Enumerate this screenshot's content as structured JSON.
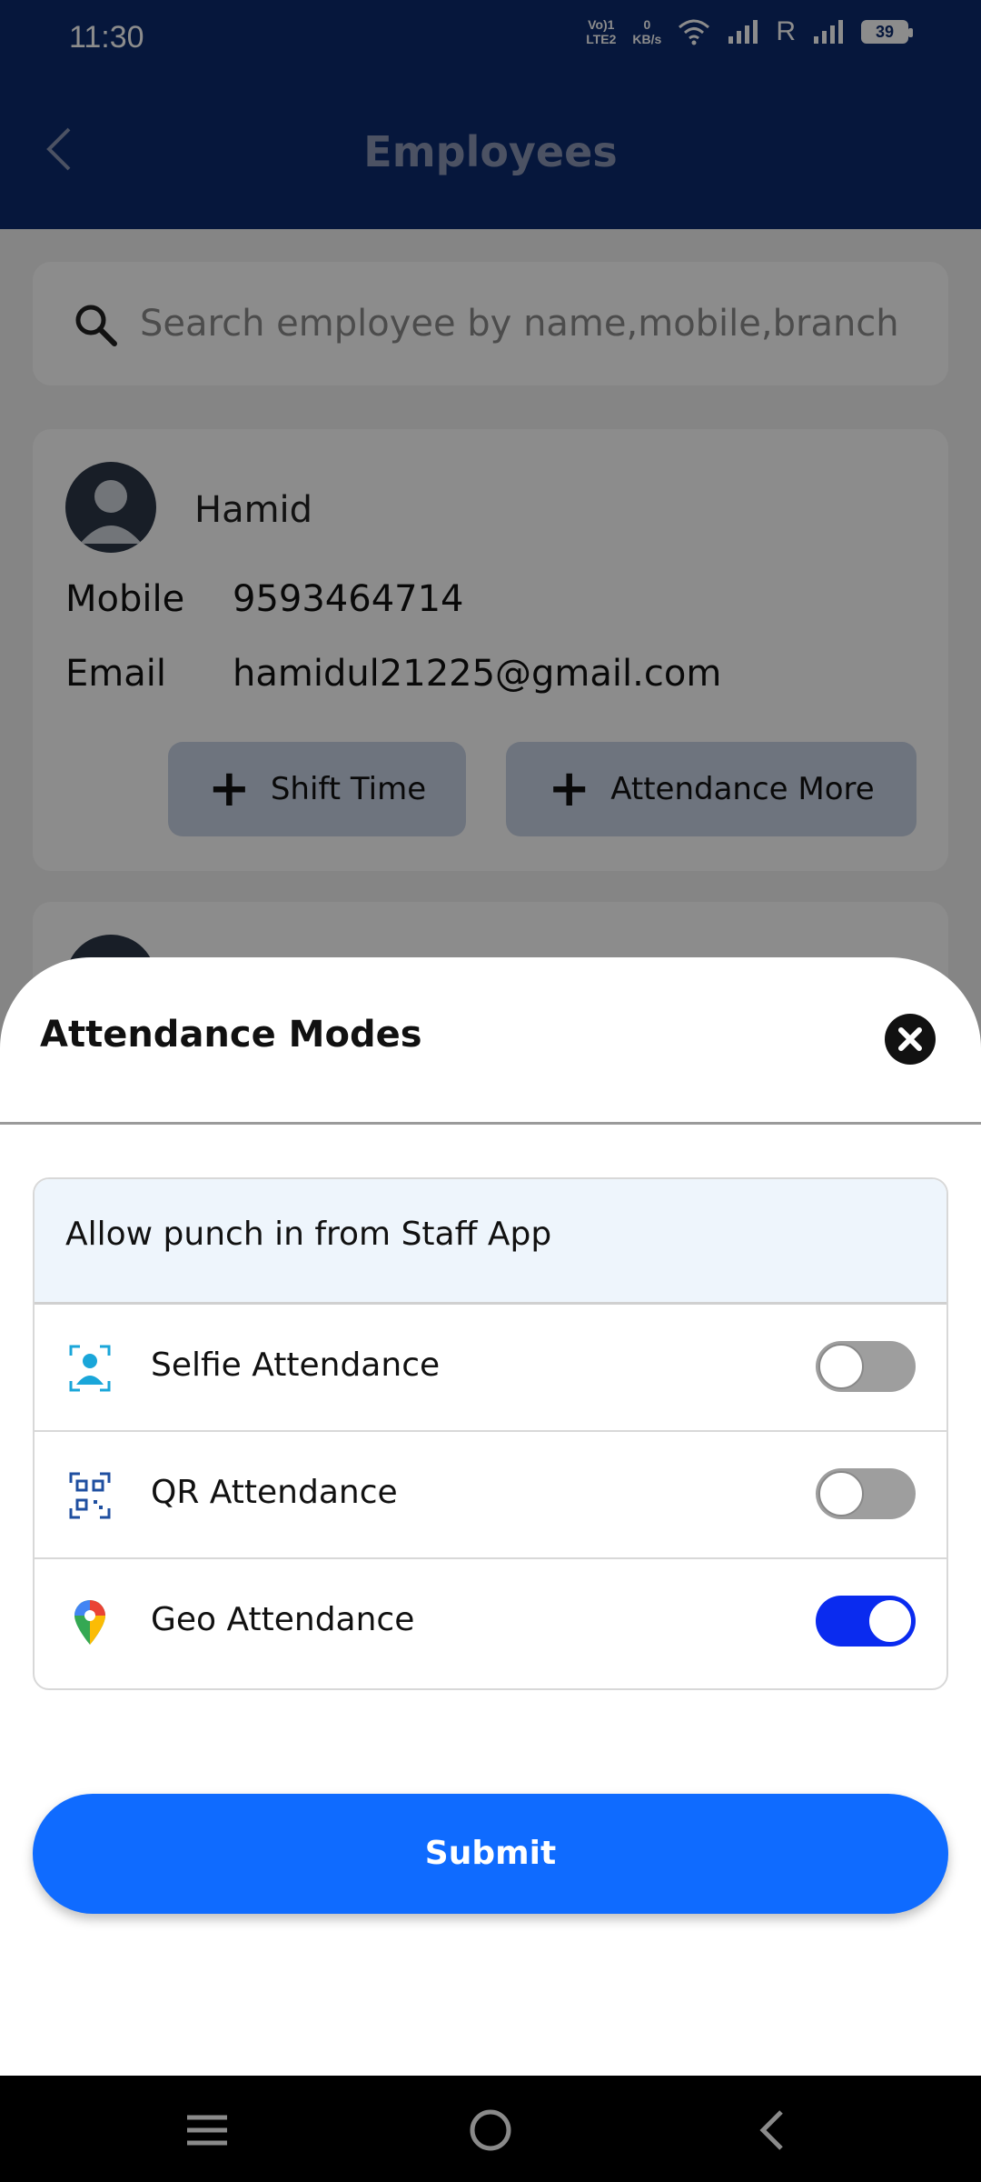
{
  "status_bar": {
    "time": "11:30",
    "volte": "Vo)1\nLTE2",
    "speed": "0\nKB/s",
    "roaming": "R",
    "battery": "39"
  },
  "header": {
    "title": "Employees",
    "back_icon": "chevron-left-icon"
  },
  "search": {
    "placeholder": "Search employee by name,mobile,branch",
    "icon": "search-icon"
  },
  "employees": [
    {
      "name": "Hamid",
      "mobile_label": "Mobile",
      "mobile": "9593464714",
      "email_label": "Email",
      "email": "hamidul21225@gmail.com",
      "actions": [
        {
          "label": "Shift Time",
          "icon": "plus-icon"
        },
        {
          "label": "Attendance More",
          "icon": "plus-icon"
        }
      ]
    }
  ],
  "sheet": {
    "title": "Attendance Modes",
    "close_icon": "close-icon",
    "section_title": "Allow punch in from Staff App",
    "modes": [
      {
        "label": "Selfie Attendance",
        "icon": "selfie-icon",
        "enabled": false
      },
      {
        "label": "QR Attendance",
        "icon": "qr-code-icon",
        "enabled": false
      },
      {
        "label": "Geo Attendance",
        "icon": "map-pin-icon",
        "enabled": true
      }
    ],
    "submit_label": "Submit"
  },
  "colors": {
    "header_bg": "#0b2a6d",
    "toggle_on": "#0a2bef",
    "submit_bg": "#0f6bff"
  },
  "nav_bar": {
    "items": [
      "menu-icon",
      "home-icon",
      "back-icon"
    ]
  }
}
